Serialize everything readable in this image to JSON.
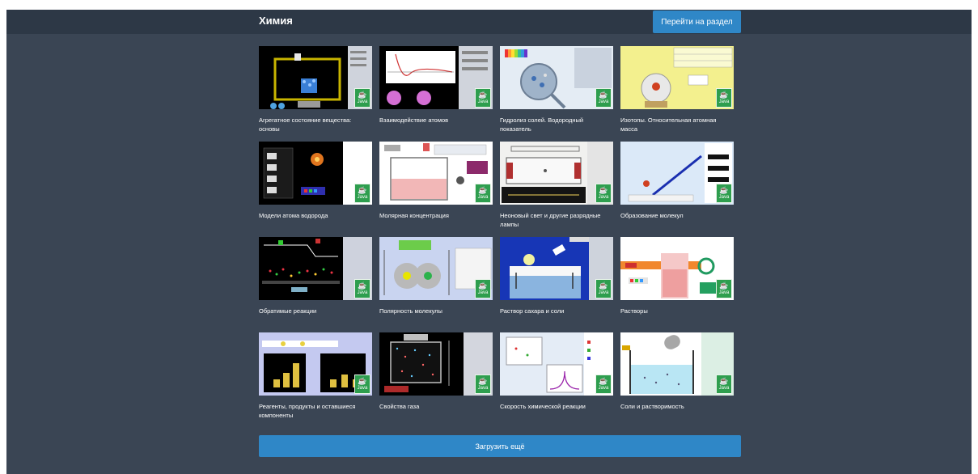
{
  "header": {
    "title": "Химия",
    "goto_label": "Перейти на раздел"
  },
  "badge_label": "Java",
  "simulations": [
    {
      "title": "Агрегатное состояние вещества: основы"
    },
    {
      "title": "Взаимодействие атомов"
    },
    {
      "title": "Гидролиз солей. Водородный показатель"
    },
    {
      "title": "Изотопы. Относительная атомная масса"
    },
    {
      "title": "Модели атома водорода"
    },
    {
      "title": "Молярная концентрация"
    },
    {
      "title": "Неоновый свет и другие разрядные лампы"
    },
    {
      "title": "Образование молекул"
    },
    {
      "title": "Обратимые реакции"
    },
    {
      "title": "Полярность молекулы"
    },
    {
      "title": "Раствор сахара и соли"
    },
    {
      "title": "Растворы"
    },
    {
      "title": "Реагенты, продукты и оставшиеся компоненты"
    },
    {
      "title": "Свойства газа"
    },
    {
      "title": "Скорость химической реакции"
    },
    {
      "title": "Соли и растворимость"
    }
  ],
  "load_more_label": "Загрузить ещё",
  "colors": {
    "panel": "#3a4554",
    "header": "#2d3846",
    "accent": "#2f87c7",
    "java_badge": "#2e9e4e"
  }
}
